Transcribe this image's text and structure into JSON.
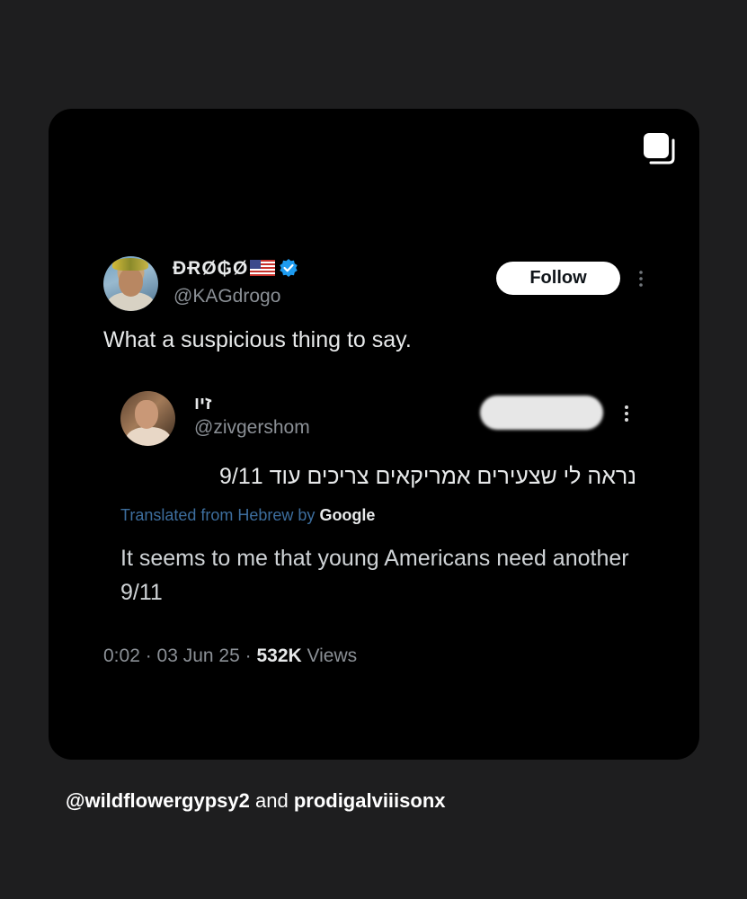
{
  "tweet": {
    "author": {
      "display_name": "ĐɌØ₲Ø",
      "flag_icon": "us-flag-icon",
      "verified_icon": "verified-badge-icon",
      "verified_color": "#1d9bf0",
      "handle": "@KAGdrogo"
    },
    "follow_label": "Follow",
    "text": "What a suspicious thing to say.",
    "quoted": {
      "display_name": "זיו",
      "handle": "@zivgershom",
      "original_text": "נראה לי שצעירים אמריקאים צריכים עוד 9/11",
      "translated_from": "Translated from Hebrew by",
      "translator": "Google",
      "translation": "It seems to me that young Americans need another 9/11"
    },
    "meta": {
      "time": "0:02",
      "date": "03 Jun 25",
      "views_count": "532K",
      "views_label": "Views"
    }
  },
  "caption": {
    "user1": "@wildflowergypsy2",
    "conjunction": "and",
    "user2": "prodigalviiisonx"
  },
  "colors": {
    "background": "#1e1e1f",
    "card": "#000000",
    "link_blue": "#3d6e9e",
    "muted_text": "#8b9096"
  }
}
